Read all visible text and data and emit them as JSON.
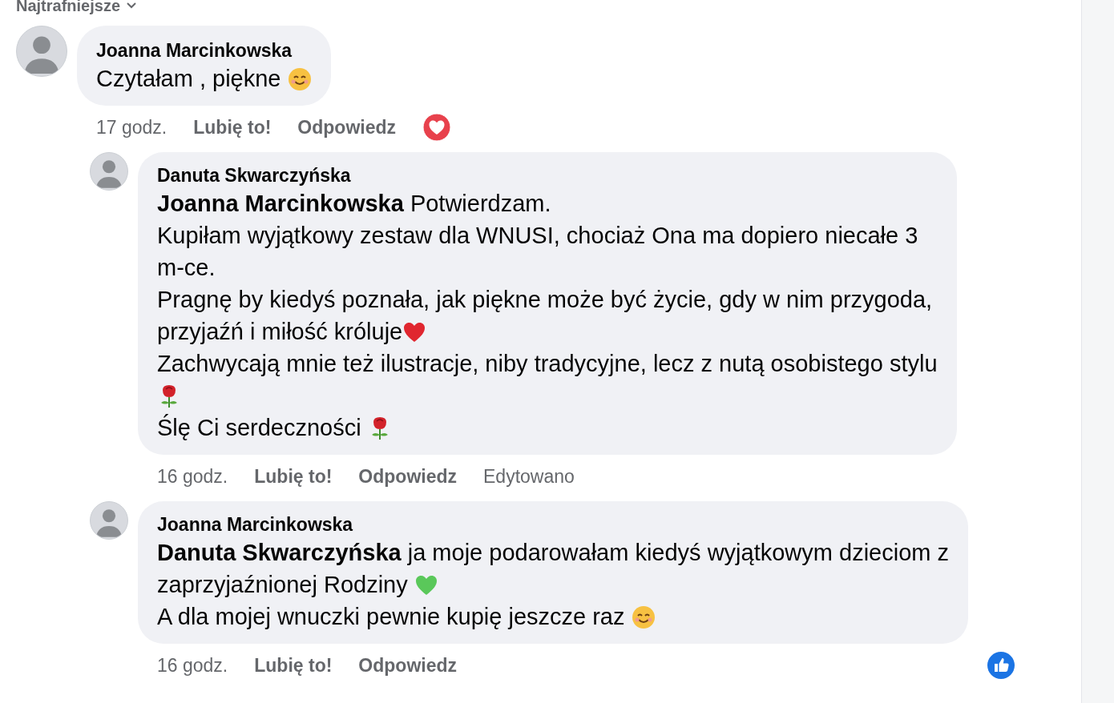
{
  "sort": {
    "label": "Najtrafniejsze"
  },
  "comments": [
    {
      "author": "Joanna Marcinkowska",
      "paragraphs": [
        [
          {
            "kind": "text",
            "text": "Czytałam , piękne "
          },
          {
            "kind": "smile"
          }
        ]
      ],
      "time": "17 godz.",
      "actions": [
        "Lubię to!",
        "Odpowiedz"
      ],
      "reaction": {
        "kind": "heart"
      },
      "replies": [
        {
          "author": "Danuta Skwarczyńska",
          "paragraphs": [
            [
              {
                "kind": "text",
                "text": "**Joanna Marcinkowska** Potwierdzam."
              }
            ],
            [
              {
                "kind": "text",
                "text": "Kupiłam wyjątkowy zestaw dla WNUSI, chociaż Ona ma dopiero niecałe 3"
              }
            ],
            [
              {
                "kind": "text",
                "text": "m-ce."
              }
            ],
            [
              {
                "kind": "text",
                "text": "Pragnę by kiedyś poznała, jak piękne może być życie, gdy w nim przygoda,"
              }
            ],
            [
              {
                "kind": "text",
                "text": "przyjaźń i miłość króluje"
              },
              {
                "kind": "heart",
                "color": "#e0262f"
              }
            ],
            [
              {
                "kind": "text",
                "text": "Zachwycają mnie też ilustracje, niby tradycyjne, lecz z nutą osobistego stylu"
              }
            ],
            [
              {
                "kind": "rose"
              }
            ],
            [
              {
                "kind": "text",
                "text": "Ślę Ci serdeczności "
              },
              {
                "kind": "rose"
              }
            ]
          ],
          "time": "16 godz.",
          "actions": [
            "Lubię to!",
            "Odpowiedz"
          ],
          "edited": "Edytowano"
        },
        {
          "author": "Joanna Marcinkowska",
          "paragraphs": [
            [
              {
                "kind": "text",
                "text": "**Danuta Skwarczyńska** ja moje podarowałam kiedyś wyjątkowym dzieciom z"
              }
            ],
            [
              {
                "kind": "text",
                "text": "zaprzyjaźnionej Rodziny "
              },
              {
                "kind": "heart",
                "color": "#5ac85a"
              }
            ],
            [
              {
                "kind": "text",
                "text": "A dla mojej wnuczki pewnie kupię jeszcze raz "
              },
              {
                "kind": "smile"
              }
            ]
          ],
          "time": "16 godz.",
          "actions": [
            "Lubię to!",
            "Odpowiedz"
          ],
          "reaction": {
            "kind": "like"
          }
        }
      ]
    }
  ]
}
